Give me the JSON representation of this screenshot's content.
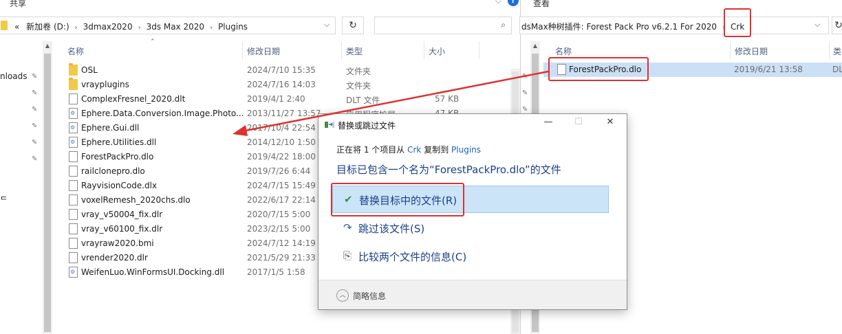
{
  "left": {
    "ribbon": {
      "share_tab": "共享"
    },
    "breadcrumb": {
      "overflow": "«",
      "segments": [
        "新加卷 (D:)",
        "3dmax2020",
        "3ds Max 2020",
        "Plugins"
      ]
    },
    "nav": {
      "items": [
        "nloads",
        "ᄃ"
      ]
    },
    "columns": {
      "name": "名称",
      "date": "修改日期",
      "type": "类型",
      "size": "大小"
    },
    "files": [
      {
        "name": "OSL",
        "date": "2024/7/10 15:35",
        "type": "文件夹",
        "size": "",
        "icon": "folder-icon"
      },
      {
        "name": "vrayplugins",
        "date": "2024/7/16 14:03",
        "type": "文件夹",
        "size": "",
        "icon": "folder-icon"
      },
      {
        "name": "ComplexFresnel_2020.dlt",
        "date": "2019/4/1 2:40",
        "type": "DLT 文件",
        "size": "57 KB",
        "icon": "file-icon"
      },
      {
        "name": "Ephere.Data.Conversion.Image.Photo...",
        "date": "2013/11/27 13:57",
        "type": "应用程序扩展",
        "size": "47 KB",
        "icon": "dll-icon"
      },
      {
        "name": "Ephere.Gui.dll",
        "date": "2017/10/4 22:54",
        "type": "",
        "size": "",
        "icon": "dll-icon"
      },
      {
        "name": "Ephere.Utilities.dll",
        "date": "2014/12/10 1:50",
        "type": "",
        "size": "",
        "icon": "dll-icon"
      },
      {
        "name": "ForestPackPro.dlo",
        "date": "2019/4/22 18:00",
        "type": "",
        "size": "",
        "icon": "file-icon"
      },
      {
        "name": "railclonepro.dlo",
        "date": "2019/7/26 6:44",
        "type": "",
        "size": "",
        "icon": "file-icon"
      },
      {
        "name": "RayvisionCode.dlx",
        "date": "2024/7/15 15:49",
        "type": "",
        "size": "",
        "icon": "file-icon"
      },
      {
        "name": "voxelRemesh_2020chs.dlo",
        "date": "2022/6/17 22:14",
        "type": "",
        "size": "",
        "icon": "file-icon"
      },
      {
        "name": "vray_v50004_fix.dlr",
        "date": "2020/7/15 5:00",
        "type": "",
        "size": "",
        "icon": "file-icon"
      },
      {
        "name": "vray_v60100_fix.dlr",
        "date": "2023/2/15 5:00",
        "type": "",
        "size": "",
        "icon": "file-icon"
      },
      {
        "name": "vrayraw2020.bmi",
        "date": "2024/7/12 14:19",
        "type": "",
        "size": "",
        "icon": "file-icon"
      },
      {
        "name": "vrender2020.dlr",
        "date": "2021/5/29 21:33",
        "type": "",
        "size": "",
        "icon": "file-icon"
      },
      {
        "name": "WeifenLuo.WinFormsUI.Docking.dll",
        "date": "2017/1/5 1:58",
        "type": "",
        "size": "",
        "icon": "dll-icon"
      }
    ]
  },
  "right": {
    "ribbon": {
      "view_tab": "查看"
    },
    "breadcrumb": {
      "parent": "dsMax种树插件: Forest Pack Pro v6.2.1 For 2020",
      "current": "Crk"
    },
    "columns": {
      "name": "名称",
      "date": "修改日期",
      "type": "类"
    },
    "files": [
      {
        "name": "ForestPackPro.dlo",
        "date": "2019/6/21 13:58",
        "type": "DL"
      }
    ]
  },
  "dialog": {
    "title": "替换或跳过文件",
    "line1_prefix": "正在将 1 个项目从",
    "line1_source": "Crk",
    "line1_mid": "复制到",
    "line1_dest": "Plugins",
    "heading": "目标已包含一个名为“ForestPackPro.dlo”的文件",
    "options": {
      "replace": "替换目标中的文件(R)",
      "skip": "跳过该文件(S)",
      "compare": "比较两个文件的信息(C)"
    },
    "footer": "简略信息",
    "controls": {
      "minimize": "—",
      "maximize": "☐",
      "close": "✕"
    }
  },
  "colors": {
    "highlight_red": "#e03030",
    "selection_blue": "#cce4f7",
    "link_blue": "#1e5fb8"
  }
}
